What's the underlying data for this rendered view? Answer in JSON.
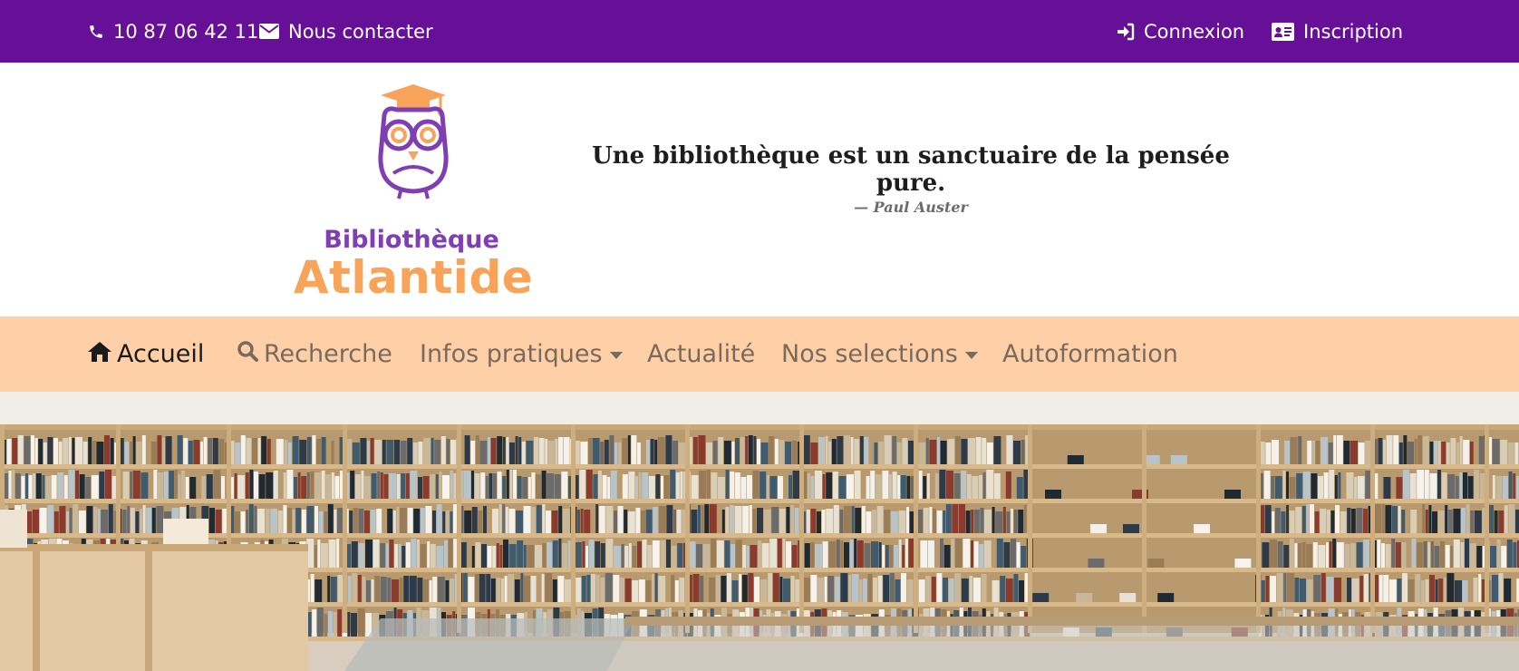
{
  "topbar": {
    "phone": "10 87 06 42 11",
    "contact": "Nous contacter",
    "login": "Connexion",
    "signup": "Inscription",
    "icons": [
      "phone-icon",
      "envelope-icon",
      "sign-in-icon",
      "id-card-icon"
    ]
  },
  "logo": {
    "line1": "Bibliothèque",
    "line2": "Atlantide"
  },
  "quote": {
    "text": "Une bibliothèque est un sanctuaire de la pensée pure.",
    "author": "—  Paul Auster"
  },
  "nav": {
    "home": "Accueil",
    "search": "Recherche",
    "infos": "Infos pratiques",
    "news": "Actualité",
    "selections": "Nos selections",
    "selfstudy": "Autoformation"
  },
  "colors": {
    "topbar": "#651096",
    "navbar": "#ffd0a7",
    "logo_purple": "#7f3fb2",
    "logo_orange": "#f7a45a"
  }
}
